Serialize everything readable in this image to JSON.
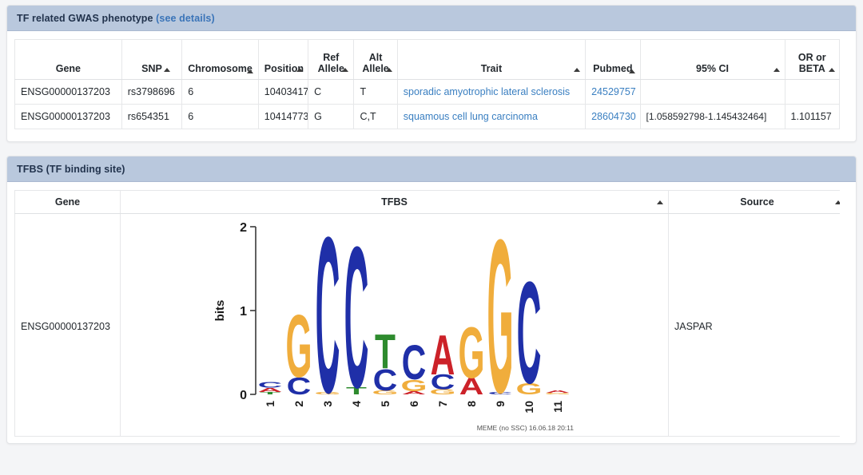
{
  "gwas_panel": {
    "title": "TF related GWAS phenotype",
    "see_details": "(see details)",
    "columns": [
      {
        "label": "Gene",
        "sortable": false
      },
      {
        "label": "SNP",
        "sortable": true
      },
      {
        "label": "Chromosome",
        "sortable": true
      },
      {
        "label": "Position",
        "sortable": true
      },
      {
        "label": "Ref Allele",
        "sortable": true
      },
      {
        "label": "Alt Allele",
        "sortable": true
      },
      {
        "label": "Trait",
        "sortable": true
      },
      {
        "label": "Pubmed",
        "sortable": true
      },
      {
        "label": "95% CI",
        "sortable": true
      },
      {
        "label": "OR or BETA",
        "sortable": true
      }
    ],
    "rows": [
      {
        "gene": "ENSG00000137203",
        "snp": "rs3798696",
        "chromosome": "6",
        "position": "10403417",
        "ref_allele": "C",
        "alt_allele": "T",
        "trait": "sporadic amyotrophic lateral sclerosis",
        "pubmed": "24529757",
        "ci": "",
        "or_beta": ""
      },
      {
        "gene": "ENSG00000137203",
        "snp": "rs654351",
        "chromosome": "6",
        "position": "10414773",
        "ref_allele": "G",
        "alt_allele": "C,T",
        "trait": "squamous cell lung carcinoma",
        "pubmed": "28604730",
        "ci": "[1.058592798-1.145432464]",
        "or_beta": "1.101157"
      }
    ]
  },
  "tfbs_panel": {
    "title": "TFBS (TF binding site)",
    "columns": [
      {
        "label": "Gene",
        "sortable": false
      },
      {
        "label": "TFBS",
        "sortable": true
      },
      {
        "label": "Source",
        "sortable": true
      }
    ],
    "rows": [
      {
        "gene": "ENSG00000137203",
        "source": "JASPAR"
      }
    ]
  },
  "sequence_logo": {
    "ylabel": "bits",
    "yticks": [
      "0",
      "1",
      "2"
    ],
    "ymax": 2,
    "footer": "MEME (no SSC) 16.06.18 20:11",
    "xticks": [
      "1",
      "2",
      "3",
      "4",
      "5",
      "6",
      "7",
      "8",
      "9",
      "10",
      "11"
    ],
    "colors": {
      "A": "#cc2229",
      "C": "#1f2fa8",
      "G": "#f0ad3c",
      "T": "#2e8b2e"
    },
    "positions": [
      {
        "pos": "1",
        "stack": [
          {
            "base": "C",
            "bits": 0.07
          },
          {
            "base": "A",
            "bits": 0.05
          },
          {
            "base": "T",
            "bits": 0.03
          }
        ]
      },
      {
        "pos": "2",
        "stack": [
          {
            "base": "G",
            "bits": 0.76
          },
          {
            "base": "C",
            "bits": 0.21
          }
        ]
      },
      {
        "pos": "3",
        "stack": [
          {
            "base": "C",
            "bits": 1.9
          },
          {
            "base": "G",
            "bits": 0.03
          }
        ]
      },
      {
        "pos": "4",
        "stack": [
          {
            "base": "C",
            "bits": 1.72
          },
          {
            "base": "T",
            "bits": 0.09
          }
        ]
      },
      {
        "pos": "5",
        "stack": [
          {
            "base": "T",
            "bits": 0.42
          },
          {
            "base": "C",
            "bits": 0.26
          },
          {
            "base": "G",
            "bits": 0.05
          }
        ]
      },
      {
        "pos": "6",
        "stack": [
          {
            "base": "C",
            "bits": 0.42
          },
          {
            "base": "G",
            "bits": 0.14
          },
          {
            "base": "A",
            "bits": 0.04
          }
        ]
      },
      {
        "pos": "7",
        "stack": [
          {
            "base": "A",
            "bits": 0.48
          },
          {
            "base": "C",
            "bits": 0.18
          },
          {
            "base": "G",
            "bits": 0.06
          }
        ]
      },
      {
        "pos": "8",
        "stack": [
          {
            "base": "G",
            "bits": 0.62
          },
          {
            "base": "A",
            "bits": 0.2
          }
        ]
      },
      {
        "pos": "9",
        "stack": [
          {
            "base": "G",
            "bits": 1.87
          },
          {
            "base": "C",
            "bits": 0.03
          }
        ]
      },
      {
        "pos": "10",
        "stack": [
          {
            "base": "C",
            "bits": 1.24
          },
          {
            "base": "G",
            "bits": 0.14
          }
        ]
      },
      {
        "pos": "11",
        "stack": [
          {
            "base": "A",
            "bits": 0.03
          },
          {
            "base": "G",
            "bits": 0.02
          }
        ]
      }
    ]
  }
}
